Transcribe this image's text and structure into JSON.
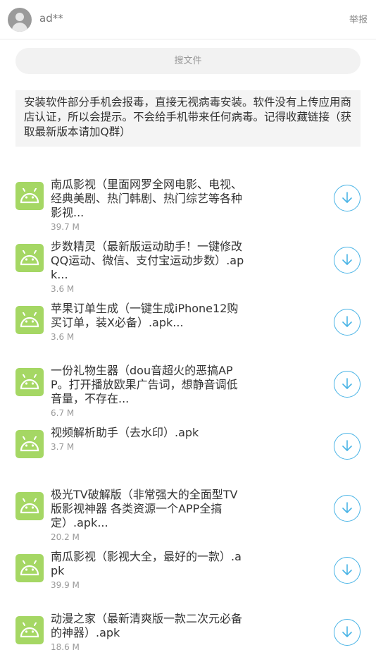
{
  "header": {
    "username": "ad**",
    "report_label": "举报"
  },
  "search": {
    "placeholder": "搜文件"
  },
  "notice": {
    "text": "安装软件部分手机会报毒，直接无视病毒安装。软件没有上传应用商店认证，所以会提示。不会给手机带来任何病毒。记得收藏链接（获取最新版本请加Q群）"
  },
  "files": [
    {
      "name": "南瓜影视（里面网罗全网电影、电视、经典美剧、热门韩剧、热门综艺等各种影视...",
      "size": "39.7 M"
    },
    {
      "name": "步数精灵（最新版运动助手！一键修改QQ运动、微信、支付宝运动步数）.apk...",
      "size": "3.6 M"
    },
    {
      "name": "苹果订单生成（一键生成iPhone12购买订单，装X必备）.apk...",
      "size": "3.6 M"
    },
    {
      "name": "一份礼物生器（dou音超火的恶搞APP。打开播放欧果广告词，想静音调低音量，不存在...",
      "size": "6.7 M"
    },
    {
      "name": "视频解析助手（去水印）.apk",
      "size": "3.7 M"
    },
    {
      "name": "极光TV破解版（非常强大的全面型TV版影视神器 各类资源一个APP全搞定）.apk...",
      "size": "20.2 M"
    },
    {
      "name": "南瓜影视（影视大全，最好的一款）.apk",
      "size": "39.9 M"
    },
    {
      "name": "动漫之家（最新清爽版一款二次元必备的神器）.apk",
      "size": "18.6 M"
    }
  ],
  "colors": {
    "android_icon": "#a5d764",
    "download_accent": "#4ab4e6"
  },
  "icons": {
    "file_icon": "android-icon",
    "action_icon": "download-icon"
  }
}
